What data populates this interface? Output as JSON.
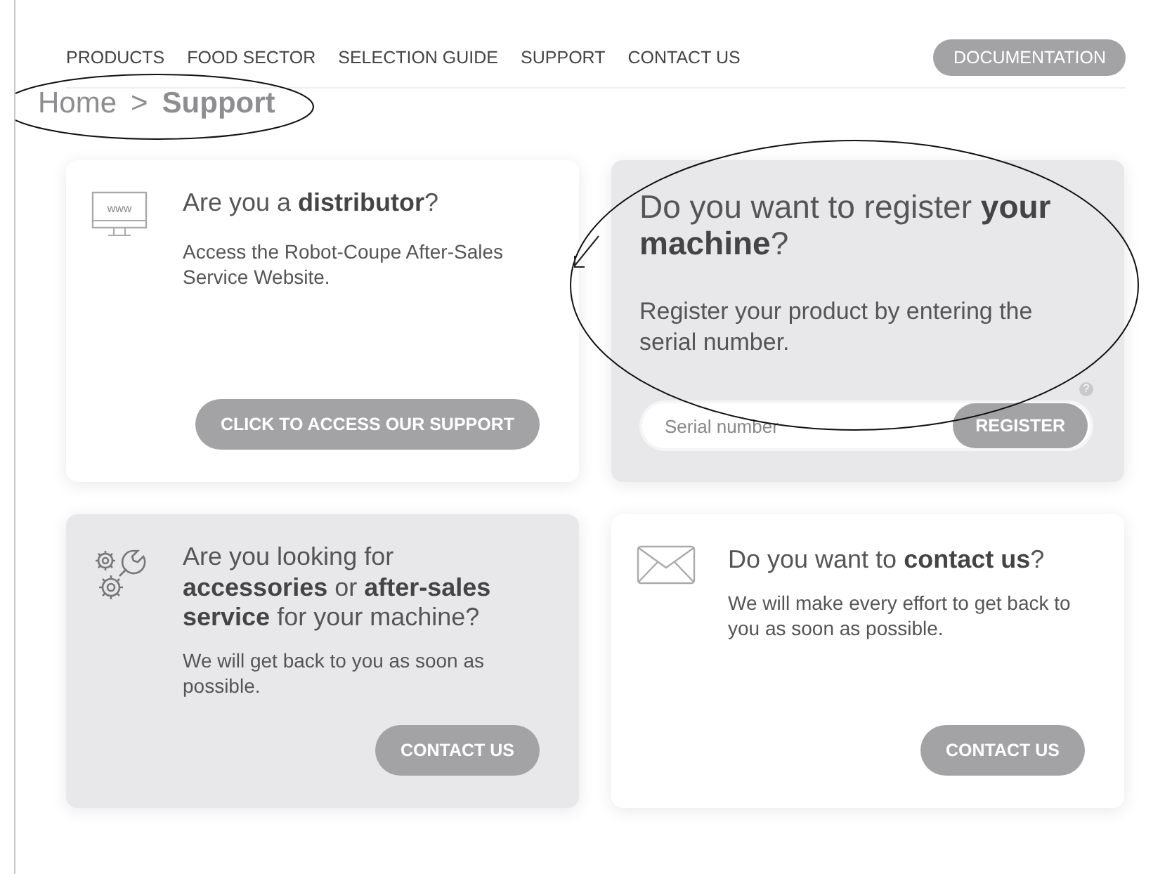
{
  "nav": {
    "items": [
      {
        "label": "PRODUCTS"
      },
      {
        "label": "FOOD SECTOR"
      },
      {
        "label": "SELECTION GUIDE"
      },
      {
        "label": "SUPPORT"
      },
      {
        "label": "CONTACT US"
      }
    ],
    "documentation_button": "DOCUMENTATION"
  },
  "breadcrumb": {
    "separator": ">",
    "items": [
      {
        "label": "Home",
        "current": false
      },
      {
        "label": "Support",
        "current": true
      }
    ]
  },
  "cards": [
    {
      "kind": "distributor",
      "shaded": false,
      "icon_label": "www",
      "title": "Are you a **distributor**?",
      "text": "Access the Robot-Coupe After-Sales Service Website.",
      "button": "CLICK TO ACCESS OUR SUPPORT"
    },
    {
      "kind": "register",
      "shaded": true,
      "title": "Do you want to register **your machine**?",
      "text": "Register your product by entering the serial number.",
      "help": "?",
      "placeholder": "Serial number",
      "button": "REGISTER"
    },
    {
      "kind": "service",
      "shaded": true,
      "title": "Are you looking for **accessories** or **after-sales service** for your machine?",
      "text": "We will get back to you as soon as possible.",
      "button": "CONTACT US"
    },
    {
      "kind": "contact",
      "shaded": false,
      "title": "Do you want to **contact us**?",
      "text": "We will make every effort to get back to you as soon as possible.",
      "button": "CONTACT US"
    }
  ]
}
